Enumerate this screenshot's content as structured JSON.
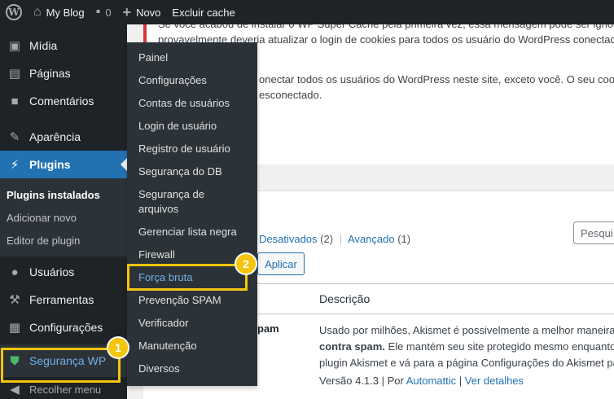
{
  "adminbar": {
    "site_name": "My Blog",
    "comments_count": "0",
    "new_label": "Novo",
    "cache_label": "Excluir cache"
  },
  "sidebar": {
    "items": [
      {
        "label": "Mídia",
        "icon": "media-icon"
      },
      {
        "label": "Páginas",
        "icon": "pages-icon"
      },
      {
        "label": "Comentários",
        "icon": "comments-icon"
      },
      {
        "label": "Aparência",
        "icon": "appearance-icon"
      },
      {
        "label": "Plugins",
        "icon": "plugins-icon"
      },
      {
        "label": "Usuários",
        "icon": "users-icon"
      },
      {
        "label": "Ferramentas",
        "icon": "tools-icon"
      },
      {
        "label": "Configurações",
        "icon": "settings-icon"
      },
      {
        "label": "Segurança WP",
        "icon": "shield-icon"
      }
    ],
    "plugins_submenu": [
      "Plugins instalados",
      "Adicionar novo",
      "Editor de plugin"
    ],
    "collapse_label": "Recolher menu"
  },
  "flyout": {
    "items": [
      "Painel",
      "Configurações",
      "Contas de usuários",
      "Login de usuário",
      "Registro de usuário",
      "Segurança do DB",
      "Segurança de arquivos",
      "Gerenciar lista negra",
      "Firewall",
      "Força bruta",
      "Prevenção SPAM",
      "Verificador",
      "Manutenção",
      "Diversos"
    ]
  },
  "notice": {
    "line1": "Se você acabou de instalar o WP Super Cache pela primeira vez, essa mensagem pode ser ignorada.",
    "line2": "provavelmente deveria atualizar o login de cookies para todos os usuário do WordPress conectados.",
    "line3": "onectar todos os usuários do WordPress neste site, exceto você. O seu cookie",
    "line4": "esconectado."
  },
  "plugins_list": {
    "filter_inactive": "Desativados",
    "filter_inactive_count": "(2)",
    "filter_sep": "|",
    "filter_advanced": "Avançado",
    "filter_advanced_count": "(1)",
    "apply_label": "Aplicar",
    "search_placeholder": "Pesqui",
    "col_description": "Descrição",
    "row_name": "pam",
    "row_desc_1": "Usado por milhões, Akismet é possivelmente a melhor maneira",
    "row_desc_2_bold": "contra spam.",
    "row_desc_2": " Ele mantém seu site protegido mesmo enquanto",
    "row_desc_3": "plugin Akismet e vá para a página Configurações do Akismet pa",
    "version_text": "Versão 4.1.3 | Por ",
    "author_link": "Automattic",
    "meta_sep": " | ",
    "details_link": "Ver detalhes"
  },
  "annotations": {
    "badge1": "1",
    "badge2": "2",
    "color": "#f6c50c"
  }
}
